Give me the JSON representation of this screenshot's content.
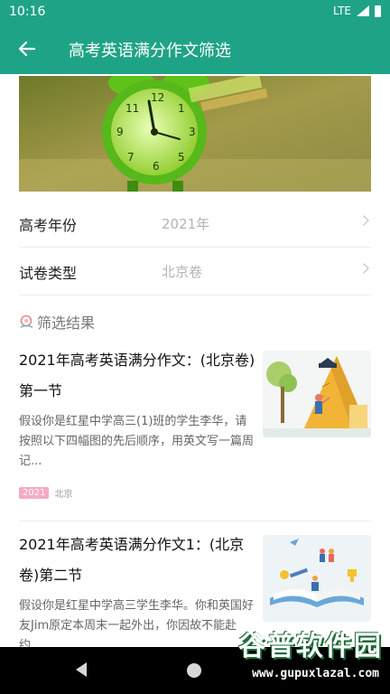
{
  "status_bar": {
    "time": "10:16",
    "network": "LTE"
  },
  "app_bar": {
    "title": "高考英语满分作文筛选"
  },
  "filters": [
    {
      "label": "高考年份",
      "value": "2021年"
    },
    {
      "label": "试卷类型",
      "value": "北京卷"
    }
  ],
  "results": {
    "title": "筛选结果",
    "items": [
      {
        "title": "2021年高考英语满分作文：(北京卷)第一节",
        "desc": "假设你是红星中学高三(1)班的学生李华，请按照以下四幅图的先后顺序，用英文写一篇周记...",
        "year_tag": "2021",
        "region_tag": "北京"
      },
      {
        "title": "2021年高考英语满分作文1：(北京卷)第二节",
        "desc": "假设你是红星中学高三学生李华。你和英国好友Jim原定本周末一起外出，你因故不能赴约..."
      }
    ]
  },
  "watermark": {
    "brand": "谷普软件园",
    "url": "www.gupuxlazal.com"
  },
  "colors": {
    "primary": "#1fa386",
    "tag_pink": "#f6a9c6"
  },
  "icons": [
    "back-arrow-icon",
    "chevron-right-icon",
    "result-marker-icon",
    "nav-back-icon",
    "nav-home-icon"
  ]
}
